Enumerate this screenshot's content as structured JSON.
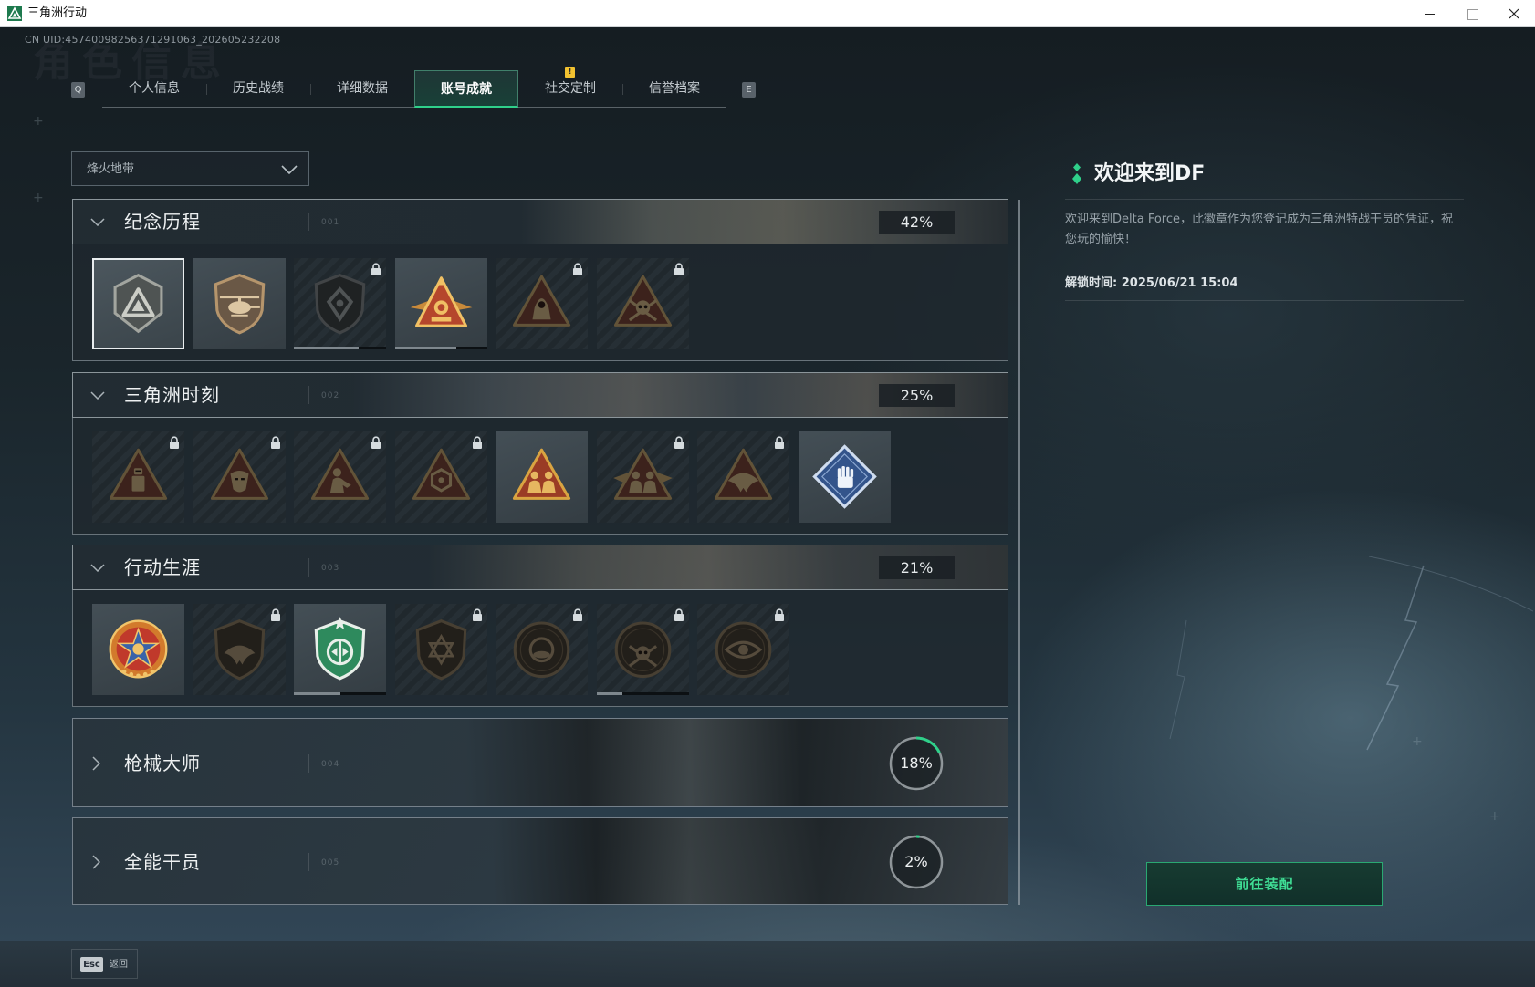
{
  "window": {
    "title": "三角洲行动",
    "icon": "delta-force-app-icon",
    "controls": [
      "minimize-icon",
      "maximize-icon",
      "close-icon"
    ]
  },
  "account": {
    "uid_text": "CN UID:45740098256371291063_202605232208"
  },
  "page_watermark": "角色信息",
  "tabs": {
    "prev_key": "Q",
    "next_key": "E",
    "items": [
      {
        "label": "个人信息"
      },
      {
        "label": "历史战绩"
      },
      {
        "label": "详细数据"
      },
      {
        "label": "账号成就",
        "active": true
      },
      {
        "label": "社交定制",
        "alert": "!"
      },
      {
        "label": "信誉档案"
      }
    ]
  },
  "mode_select": {
    "value": "烽火地带",
    "icon": "chevron-down-icon"
  },
  "sections": [
    {
      "number": "001",
      "title": "纪念历程",
      "expanded": true,
      "progress": "42%",
      "badges": [
        {
          "icon": "delta-hex-shield-icon",
          "locked": false,
          "selected": true
        },
        {
          "icon": "helicopter-shield-icon",
          "locked": false
        },
        {
          "icon": "hex-emblem-shield-icon",
          "locked": true,
          "progress": 0.7
        },
        {
          "icon": "golden-winged-triangle-icon",
          "locked": false,
          "progress": 0.67
        },
        {
          "icon": "hooded-operator-triangle-icon",
          "locked": true
        },
        {
          "icon": "skull-triangle-icon",
          "locked": true
        }
      ]
    },
    {
      "number": "002",
      "title": "三角洲时刻",
      "expanded": true,
      "progress": "25%",
      "badges": [
        {
          "icon": "robot-triangle-icon",
          "locked": true
        },
        {
          "icon": "mask-triangle-icon",
          "locked": true
        },
        {
          "icon": "kneeling-soldier-triangle-icon",
          "locked": true
        },
        {
          "icon": "knight-triangle-icon",
          "locked": true
        },
        {
          "icon": "squad-triangle-icon",
          "locked": false
        },
        {
          "icon": "heroes-triangle-icon",
          "locked": true
        },
        {
          "icon": "eagle-triangle-icon",
          "locked": true
        },
        {
          "icon": "hand-diamond-icon",
          "locked": false
        }
      ]
    },
    {
      "number": "003",
      "title": "行动生涯",
      "expanded": true,
      "progress": "21%",
      "badges": [
        {
          "icon": "star-medal-icon",
          "locked": false
        },
        {
          "icon": "eagle-shield-icon",
          "locked": true
        },
        {
          "icon": "green-shield-icon",
          "locked": false,
          "progress": 0.5
        },
        {
          "icon": "hexagram-shield-icon",
          "locked": true
        },
        {
          "icon": "orb-circle-icon",
          "locked": true
        },
        {
          "icon": "skull-circle-icon",
          "locked": true,
          "progress": 0.28
        },
        {
          "icon": "eye-circle-icon",
          "locked": true
        }
      ]
    },
    {
      "number": "004",
      "title": "枪械大师",
      "expanded": false,
      "progress": "18%"
    },
    {
      "number": "005",
      "title": "全能干员",
      "expanded": false,
      "progress": "2%"
    }
  ],
  "detail": {
    "icon": "diamond-marker-icon",
    "title": "欢迎来到DF",
    "description": "欢迎来到Delta Force，此徽章作为您登记成为三角洲特战干员的凭证，祝您玩的愉快！",
    "unlock_time": "解锁时间: 2025/06/21 15:04",
    "equip_button": "前往装配"
  },
  "footer": {
    "back_key": "Esc",
    "back_label": "返回"
  },
  "colors": {
    "accent_green": "#2fd08a",
    "alert_yellow": "#f2c230",
    "badge_gold": "#d9a441",
    "badge_red": "#9a3c25",
    "background": "#1b242a"
  }
}
